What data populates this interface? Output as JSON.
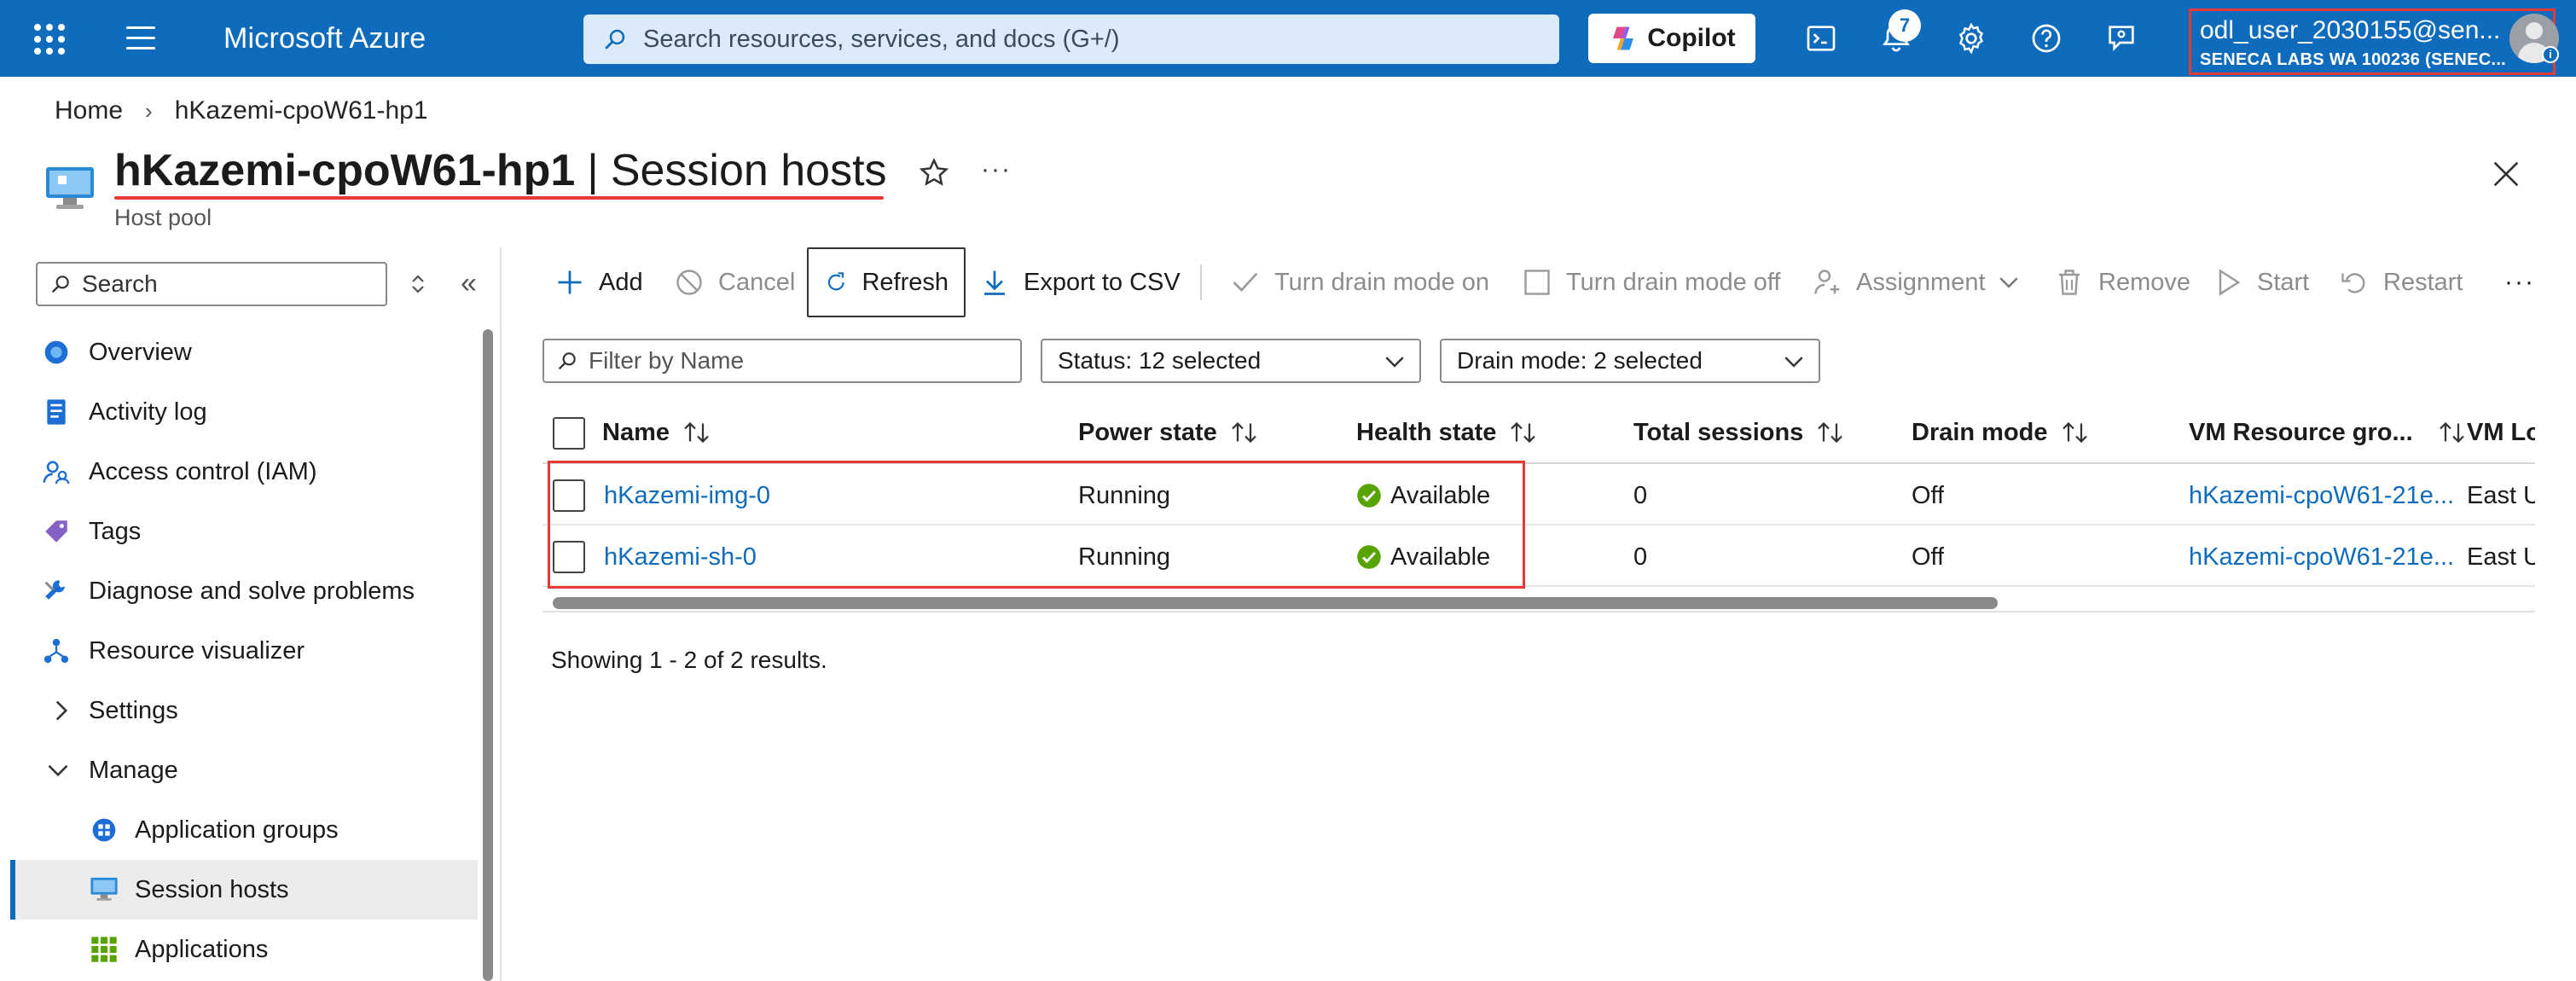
{
  "topbar": {
    "brand": "Microsoft Azure",
    "search_placeholder": "Search resources, services, and docs (G+/)",
    "copilot_label": "Copilot",
    "notification_count": "7",
    "account_name": "odl_user_2030155@sen...",
    "account_tenant": "SENECA LABS WA 100236 (SENEC..."
  },
  "breadcrumb": {
    "home": "Home",
    "current": "hKazemi-cpoW61-hp1"
  },
  "header": {
    "resource_name": "hKazemi-cpoW61-hp1",
    "separator": "|",
    "page_name": "Session hosts",
    "subtitle": "Host pool",
    "more": "···"
  },
  "nav": {
    "search_placeholder": "Search",
    "items": [
      {
        "label": "Overview",
        "icon": "overview-icon"
      },
      {
        "label": "Activity log",
        "icon": "activity-log-icon"
      },
      {
        "label": "Access control (IAM)",
        "icon": "iam-icon"
      },
      {
        "label": "Tags",
        "icon": "tag-icon"
      },
      {
        "label": "Diagnose and solve problems",
        "icon": "wrench-icon"
      },
      {
        "label": "Resource visualizer",
        "icon": "visualizer-icon"
      },
      {
        "label": "Settings",
        "icon": "chevron-right-icon"
      },
      {
        "label": "Manage",
        "icon": "chevron-down-icon"
      },
      {
        "label": "Application groups",
        "icon": "app-groups-icon"
      },
      {
        "label": "Session hosts",
        "icon": "monitor-icon"
      },
      {
        "label": "Applications",
        "icon": "grid-icon"
      }
    ]
  },
  "toolbar": {
    "add": "Add",
    "cancel": "Cancel",
    "refresh": "Refresh",
    "export": "Export to CSV",
    "drain_on": "Turn drain mode on",
    "drain_off": "Turn drain mode off",
    "assignment": "Assignment",
    "remove": "Remove",
    "start": "Start",
    "restart": "Restart",
    "more": "···"
  },
  "filters": {
    "name_placeholder": "Filter by Name",
    "status": "Status: 12 selected",
    "drain": "Drain mode: 2 selected"
  },
  "grid": {
    "columns": [
      "Name",
      "Power state",
      "Health state",
      "Total sessions",
      "Drain mode",
      "VM Resource gro...",
      "VM Lo"
    ],
    "rows": [
      {
        "name": "hKazemi-img-0",
        "power": "Running",
        "health": "Available",
        "sessions": "0",
        "drain": "Off",
        "rg": "hKazemi-cpoW61-21e...",
        "loc": "East U"
      },
      {
        "name": "hKazemi-sh-0",
        "power": "Running",
        "health": "Available",
        "sessions": "0",
        "drain": "Off",
        "rg": "hKazemi-cpoW61-21e...",
        "loc": "East U"
      }
    ],
    "footer": "Showing 1 - 2 of 2 results."
  },
  "colors": {
    "brand_blue": "#0f6cbd",
    "highlight_red": "#e53935",
    "available_green": "#57a300"
  }
}
